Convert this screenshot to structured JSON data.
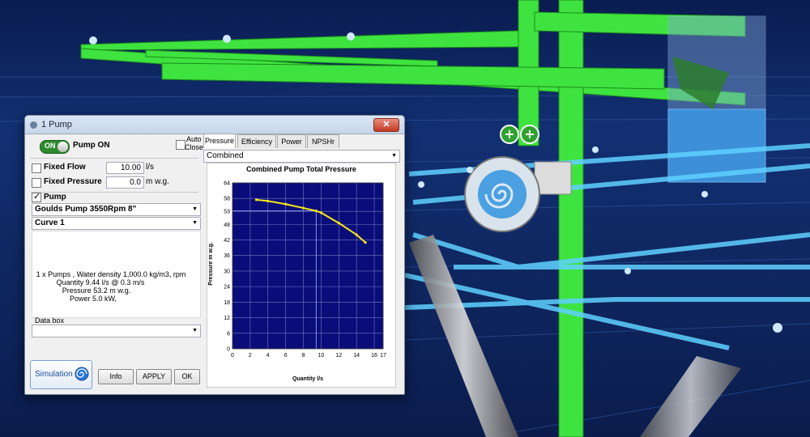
{
  "dialog": {
    "title": "1 Pump",
    "close_label": "✕",
    "pump_toggle": "ON",
    "pump_on_label": "Pump ON",
    "auto_close_label_1": "Auto",
    "auto_close_label_2": "Close",
    "fixed_flow_label": "Fixed Flow",
    "fixed_flow_value": "10.00",
    "fixed_flow_unit": "l/s",
    "fixed_pressure_label": "Fixed Pressure",
    "fixed_pressure_value": "0.0",
    "fixed_pressure_unit": "m w.g.",
    "pump_label": "Pump",
    "pump_model": "Goulds Pump 3550Rpm 8\"",
    "curve": "Curve 1",
    "info_lines": [
      "1 x Pumps ,  Water density  1,000.0 kg/m3,  rpm",
      "Quantity  9.44 l/s @  0.3 m/s",
      "Pressure  53.2 m w.g.",
      "Power  5.0 kW,"
    ],
    "data_box_label": "Data box",
    "simulation_label": "Simulation",
    "info_button": "Info",
    "apply_button": "APPLY",
    "ok_button": "OK",
    "tabs": [
      "Pressure",
      "Efficiency",
      "Power",
      "NPSHr"
    ],
    "chart_mode": "Combined"
  },
  "chart_data": {
    "type": "line",
    "title": "Combined Pump Total Pressure",
    "xlabel": "Quantity l/s",
    "ylabel": "Pressure m w.g.",
    "xlim": [
      0,
      17
    ],
    "ylim": [
      0,
      64
    ],
    "xticks": [
      0,
      2,
      4,
      6,
      8,
      10,
      12,
      14,
      16,
      17
    ],
    "yticks": [
      0,
      6,
      12,
      18,
      24,
      30,
      36,
      42,
      48,
      53,
      58,
      64
    ],
    "operating_point": {
      "x": 9.44,
      "y": 53.2
    },
    "series": [
      {
        "color": "#f5e61a",
        "x": [
          2.7,
          4,
          6,
          8,
          9.44,
          10,
          12,
          14,
          15
        ],
        "y": [
          57.5,
          57.0,
          55.8,
          54.3,
          53.2,
          52.5,
          48.5,
          44.0,
          41.0
        ]
      }
    ],
    "background": "#0a0c7a",
    "grid": true
  }
}
